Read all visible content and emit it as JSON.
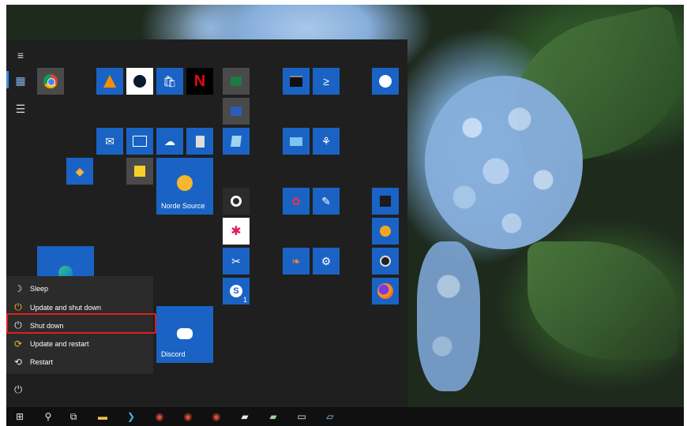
{
  "rail": {
    "hamburger_icon": "hamburger-icon",
    "tiles_icon": "tiles-icon",
    "list_icon": "list-icon"
  },
  "tiles": {
    "norde_source_label": "Norde Source",
    "discord_label": "Discord",
    "skype_badge": "1"
  },
  "power_menu": {
    "sleep": "Sleep",
    "update_shutdown": "Update and shut down",
    "shutdown": "Shut down",
    "update_restart": "Update and restart",
    "restart": "Restart"
  },
  "colors": {
    "tile_blue": "#1a63c4",
    "highlight_red": "#e01e1e",
    "menu_bg": "#1f1f1f"
  }
}
